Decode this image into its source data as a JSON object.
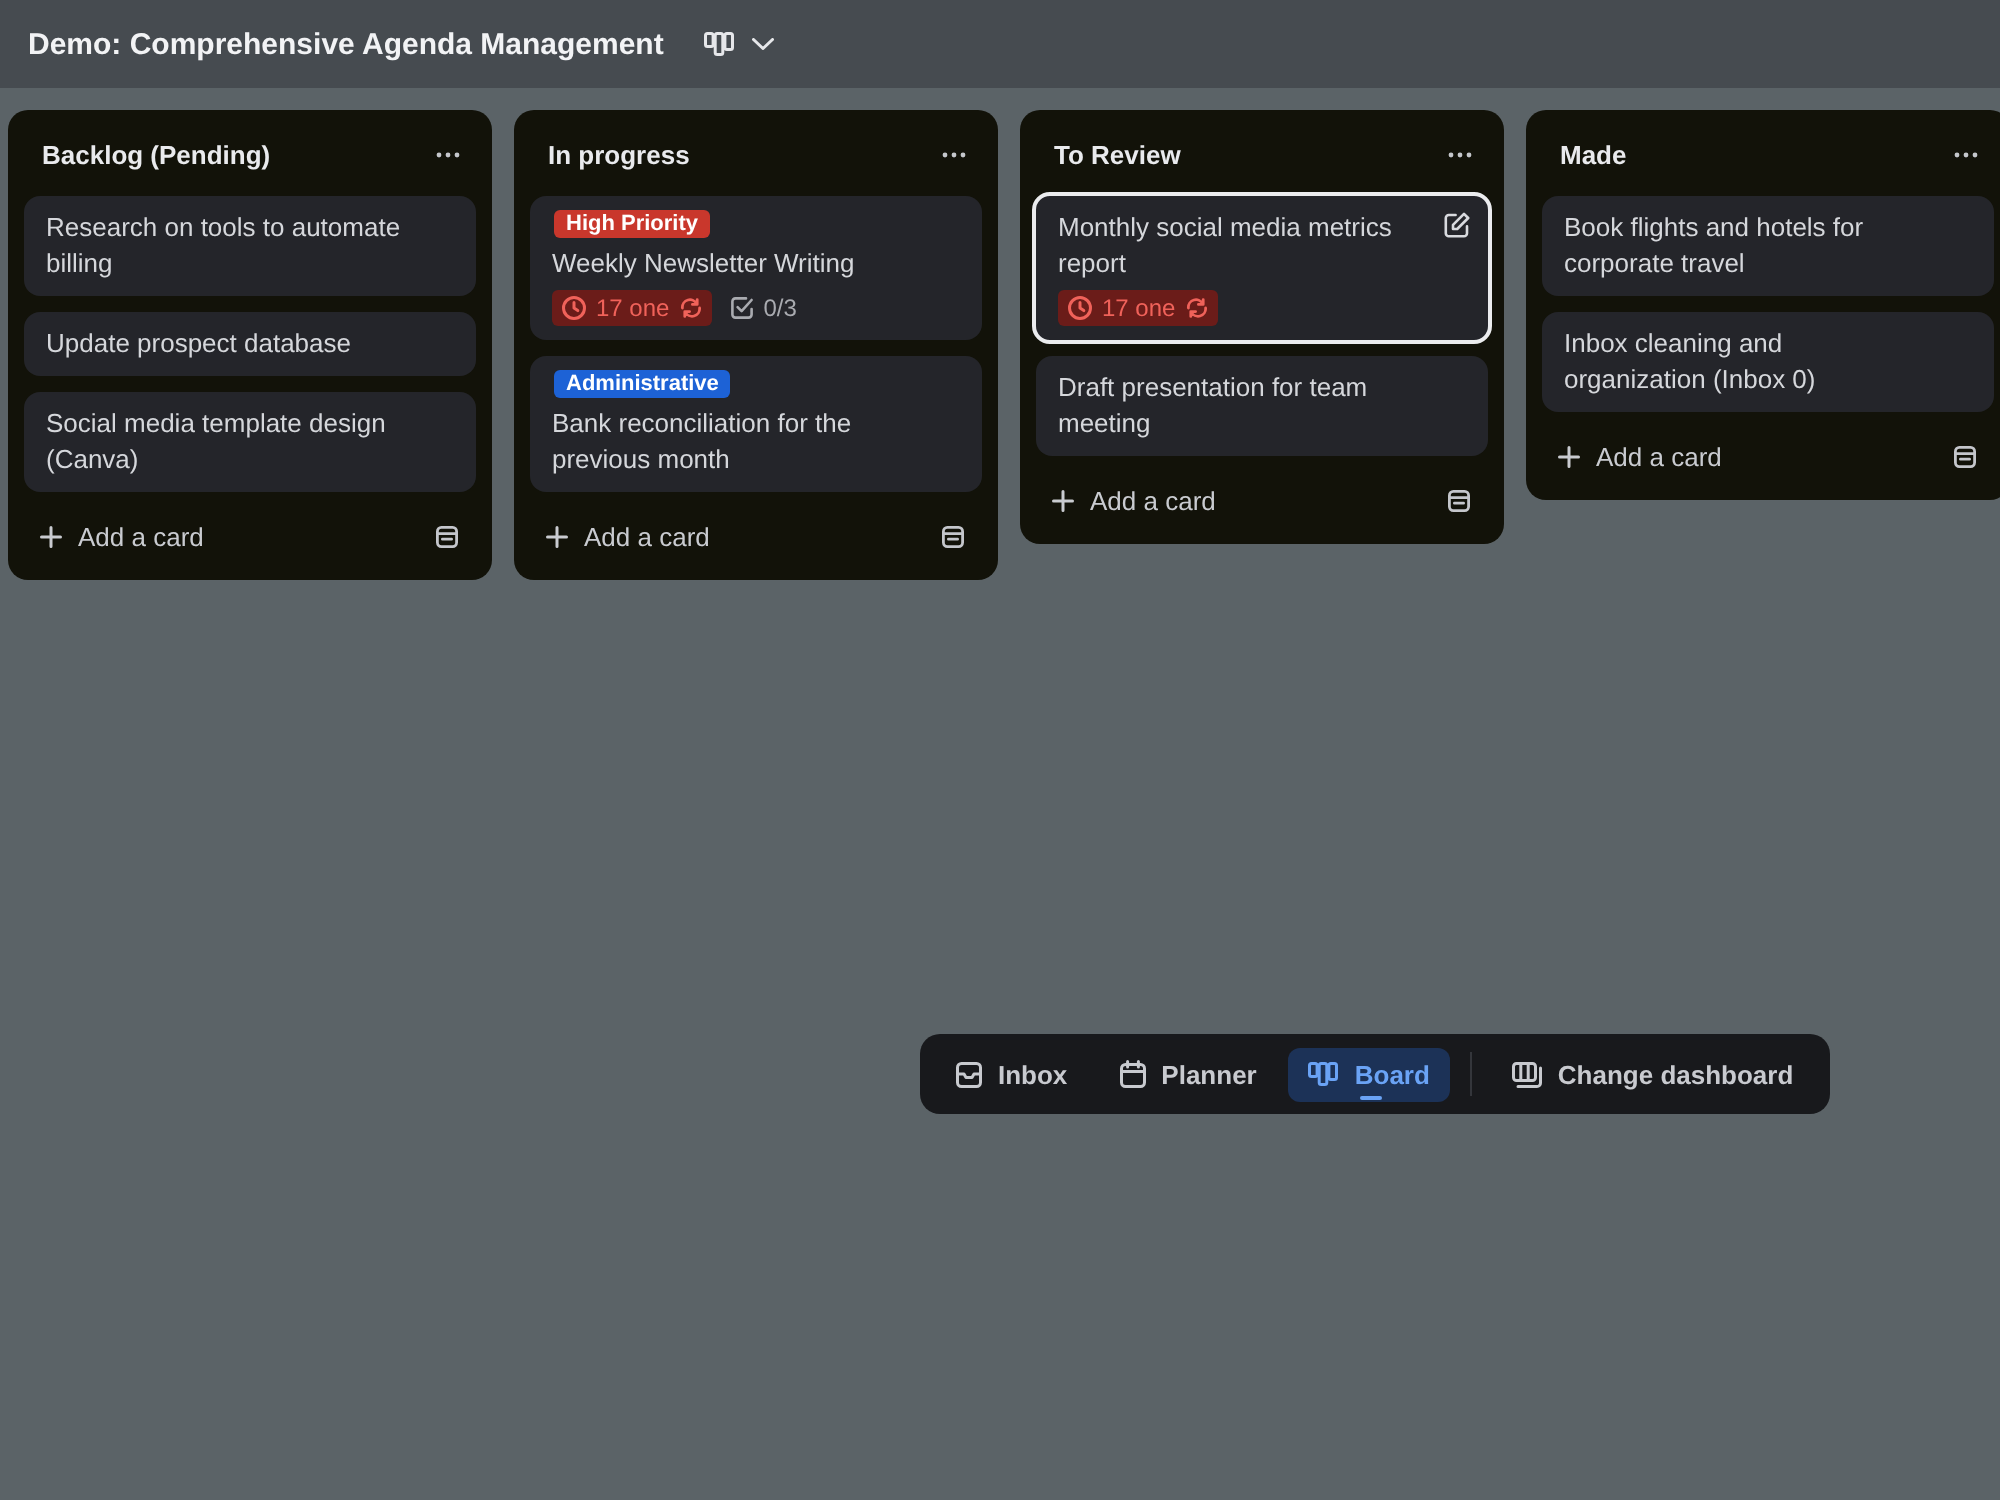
{
  "header": {
    "title": "Demo: Comprehensive Agenda Management"
  },
  "lists": [
    {
      "title": "Backlog (Pending)",
      "cards": [
        {
          "title": "Research on tools to automate billing",
          "selected": false
        },
        {
          "title": "Update prospect database",
          "selected": false
        },
        {
          "title": "Social media template design (Canva)",
          "selected": false
        }
      ],
      "add_button": "Add a card"
    },
    {
      "title": "In progress",
      "cards": [
        {
          "labels": [
            {
              "text": "High Priority",
              "color": "#c9372c"
            }
          ],
          "title": "Weekly Newsletter Writing",
          "due": {
            "text": "17 one",
            "overdue": true,
            "recurring": true
          },
          "checklist": "0/3",
          "selected": false
        },
        {
          "labels": [
            {
              "text": "Administrative",
              "color": "#1d62d6"
            }
          ],
          "title": "Bank reconciliation for the previous month",
          "selected": false
        }
      ],
      "add_button": "Add a card"
    },
    {
      "title": "To Review",
      "cards": [
        {
          "title": "Monthly social media metrics report",
          "due": {
            "text": "17 one",
            "overdue": true,
            "recurring": true
          },
          "selected": true
        },
        {
          "title": "Draft presentation for team meeting",
          "selected": false
        }
      ],
      "add_button": "Add a card"
    },
    {
      "title": "Made",
      "cards": [
        {
          "title": "Book flights and hotels for corporate travel",
          "selected": false
        },
        {
          "title": "Inbox cleaning and organization (Inbox 0)",
          "selected": false
        }
      ],
      "add_button": "Add a card"
    }
  ],
  "dock": {
    "tabs": [
      {
        "label": "Inbox",
        "selected": false
      },
      {
        "label": "Planner",
        "selected": false
      },
      {
        "label": "Board",
        "selected": true
      }
    ],
    "action": "Change dashboard"
  }
}
